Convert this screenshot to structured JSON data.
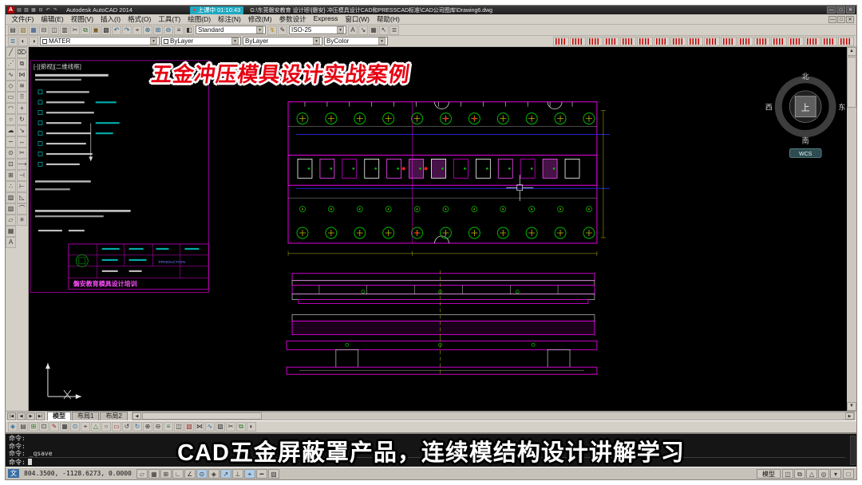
{
  "window": {
    "ui": {
      "dropdown_arrow": "▾",
      "scroll_up": "▲",
      "scroll_down": "▼",
      "scroll_left": "◀",
      "scroll_right": "▶"
    },
    "title_bar": {
      "logo": "A",
      "quick_icons": [
        {
          "name": "qat-new-icon",
          "glyph": "▤"
        },
        {
          "name": "qat-open-icon",
          "glyph": "▧"
        },
        {
          "name": "qat-save-icon",
          "glyph": "▦"
        },
        {
          "name": "qat-plot-icon",
          "glyph": "⊟"
        },
        {
          "name": "qat-undo-icon",
          "glyph": "↶"
        },
        {
          "name": "qat-redo-icon",
          "glyph": "↷"
        }
      ],
      "app_title": "Autodesk AutoCAD 2014",
      "recording_badge": {
        "dot": "●",
        "label": "上课中",
        "time": "01:10:43"
      },
      "doc_path": "G:\\东莞磐安教育 设计班\\[磐安]·冲压模具设计CAD和PRESSCAD标准\\CAD公司图库\\Drawing6.dwg",
      "window_buttons": [
        {
          "name": "minimize-button",
          "label": "—"
        },
        {
          "name": "restore-button",
          "label": "□"
        },
        {
          "name": "close-button",
          "label": "✕"
        }
      ]
    },
    "menu_bar": {
      "items": [
        {
          "name": "menu-file",
          "label": "文件(F)"
        },
        {
          "name": "menu-edit",
          "label": "编辑(E)"
        },
        {
          "name": "menu-view",
          "label": "视图(V)"
        },
        {
          "name": "menu-insert",
          "label": "插入(I)"
        },
        {
          "name": "menu-format",
          "label": "格式(O)"
        },
        {
          "name": "menu-tools",
          "label": "工具(T)"
        },
        {
          "name": "menu-draw",
          "label": "绘图(D)"
        },
        {
          "name": "menu-dimension",
          "label": "标注(N)"
        },
        {
          "name": "menu-modify",
          "label": "修改(M)"
        },
        {
          "name": "menu-parametric-design",
          "label": "参数设计"
        },
        {
          "name": "menu-express",
          "label": "Express"
        },
        {
          "name": "menu-window",
          "label": "窗口(W)"
        },
        {
          "name": "menu-help",
          "label": "帮助(H)"
        }
      ],
      "mdi_buttons": [
        {
          "name": "mdi-minimize-button",
          "label": "—"
        },
        {
          "name": "mdi-restore-button",
          "label": "□"
        },
        {
          "name": "mdi-close-button",
          "label": "✕"
        }
      ]
    },
    "toolbar_main": {
      "left_icons": [
        {
          "name": "new-icon",
          "glyph": "▤"
        },
        {
          "name": "open-icon",
          "glyph": "▧",
          "color": "#8a6d2a"
        },
        {
          "name": "save-icon",
          "glyph": "▦",
          "color": "#33568a"
        },
        {
          "name": "plot-icon",
          "glyph": "⊟"
        },
        {
          "name": "plot-preview-icon",
          "glyph": "◫"
        },
        {
          "name": "publish-icon",
          "glyph": "▥"
        },
        {
          "name": "cut-icon",
          "glyph": "✂"
        },
        {
          "name": "copy-clip-icon",
          "glyph": "⧉",
          "color": "#2e6b2e"
        },
        {
          "name": "paste-icon",
          "glyph": "▣",
          "color": "#7a5a1f"
        },
        {
          "name": "match-properties-icon",
          "glyph": "▩"
        },
        {
          "name": "undo-icon",
          "glyph": "↶",
          "color": "#1c5c8a"
        },
        {
          "name": "redo-icon",
          "glyph": "↷",
          "color": "#1c5c8a"
        },
        {
          "name": "pan-icon",
          "glyph": "⌖"
        },
        {
          "name": "zoom-realtime-icon",
          "glyph": "⊕",
          "color": "#1c5c8a"
        },
        {
          "name": "zoom-window-icon",
          "glyph": "⊞",
          "color": "#1c5c8a"
        },
        {
          "name": "zoom-previous-icon",
          "glyph": "⊖",
          "color": "#1c5c8a"
        },
        {
          "name": "properties-icon",
          "glyph": "≡"
        },
        {
          "name": "designcenter-icon",
          "glyph": "◧"
        }
      ],
      "style_combo": "Standard",
      "mid_icons": [
        {
          "name": "parametric-icon",
          "glyph": "↯",
          "color": "#b8860b"
        },
        {
          "name": "annotation-icon",
          "glyph": "✎"
        }
      ],
      "dim_combo": "ISO-25",
      "right_icons": [
        {
          "name": "text-style-icon",
          "glyph": "A"
        },
        {
          "name": "dim-style-icon",
          "glyph": "↘"
        },
        {
          "name": "table-style-icon",
          "glyph": "▦"
        },
        {
          "name": "mleader-style-icon",
          "glyph": "↖"
        },
        {
          "name": "layer-states-icon",
          "glyph": "≣"
        }
      ]
    },
    "toolbar_properties": {
      "layer_icons": [
        {
          "name": "layer-properties-icon",
          "glyph": "≣",
          "color": "#1c5c8a"
        },
        {
          "name": "layer-isolate-icon",
          "glyph": "◐"
        },
        {
          "name": "layer-unisolate-icon",
          "glyph": "◑"
        }
      ],
      "layer_combo": "MATER",
      "color_combo": "ByLayer",
      "linetype_combo": "ByLayer",
      "plot_combo": "ByColor",
      "presscad_tools": [
        {
          "name": "presscad-tool-icon"
        },
        {
          "name": "presscad-tool-icon"
        },
        {
          "name": "presscad-tool-icon"
        },
        {
          "name": "presscad-tool-icon"
        },
        {
          "name": "presscad-tool-icon"
        },
        {
          "name": "presscad-tool-icon"
        },
        {
          "name": "presscad-tool-icon"
        },
        {
          "name": "presscad-tool-icon"
        },
        {
          "name": "presscad-tool-icon"
        },
        {
          "name": "presscad-tool-icon"
        },
        {
          "name": "presscad-tool-icon"
        },
        {
          "name": "presscad-tool-icon"
        },
        {
          "name": "presscad-tool-icon"
        },
        {
          "name": "presscad-tool-icon"
        },
        {
          "name": "presscad-tool-icon"
        },
        {
          "name": "presscad-tool-icon"
        },
        {
          "name": "presscad-tool-icon"
        },
        {
          "name": "presscad-tool-icon"
        }
      ]
    },
    "left_dock": {
      "draw_icons": [
        {
          "name": "line-icon",
          "glyph": "╱"
        },
        {
          "name": "construction-line-icon",
          "glyph": "⋰"
        },
        {
          "name": "polyline-icon",
          "glyph": "∿"
        },
        {
          "name": "polygon-icon",
          "glyph": "◇"
        },
        {
          "name": "rectangle-icon",
          "glyph": "▭"
        },
        {
          "name": "arc-icon",
          "glyph": "◠"
        },
        {
          "name": "circle-icon",
          "glyph": "○"
        },
        {
          "name": "revision-cloud-icon",
          "glyph": "☁"
        },
        {
          "name": "spline-icon",
          "glyph": "∽"
        },
        {
          "name": "ellipse-icon",
          "glyph": "⊙"
        },
        {
          "name": "insert-block-icon",
          "glyph": "⊡"
        },
        {
          "name": "make-block-icon",
          "glyph": "⊞"
        },
        {
          "name": "point-icon",
          "glyph": "∴"
        },
        {
          "name": "hatch-icon",
          "glyph": "▨"
        },
        {
          "name": "gradient-icon",
          "glyph": "▧"
        },
        {
          "name": "region-icon",
          "glyph": "▱"
        },
        {
          "name": "table-icon",
          "glyph": "▦"
        },
        {
          "name": "multiline-text-icon",
          "glyph": "A"
        }
      ],
      "modify_icons": [
        {
          "name": "erase-icon",
          "glyph": "⌦"
        },
        {
          "name": "copy-icon",
          "glyph": "⧉"
        },
        {
          "name": "mirror-icon",
          "glyph": "⋈"
        },
        {
          "name": "offset-icon",
          "glyph": "≋"
        },
        {
          "name": "array-icon",
          "glyph": "⠿"
        },
        {
          "name": "move-icon",
          "glyph": "+"
        },
        {
          "name": "rotate-icon",
          "glyph": "↻"
        },
        {
          "name": "scale-icon",
          "glyph": "↘"
        },
        {
          "name": "stretch-icon",
          "glyph": "↔"
        },
        {
          "name": "trim-icon",
          "glyph": "✂"
        },
        {
          "name": "extend-icon",
          "glyph": "⟶"
        },
        {
          "name": "break-icon",
          "glyph": "⊣"
        },
        {
          "name": "join-icon",
          "glyph": "⊢"
        },
        {
          "name": "chamfer-icon",
          "glyph": "◺"
        },
        {
          "name": "fillet-icon",
          "glyph": "⌒"
        },
        {
          "name": "explode-icon",
          "glyph": "✳"
        }
      ]
    },
    "canvas": {
      "viewport_label": "[-][俯视][二维线框]",
      "title_block_company": "磐安教育模具设计培训",
      "title_block_production": "PRODUCTION"
    },
    "viewcube": {
      "north": "北",
      "south": "南",
      "west": "西",
      "east": "东",
      "top": "上",
      "wcs": "WCS"
    },
    "overlays": {
      "top_title": "五金冲压模具设计实战案例",
      "bottom_title": "CAD五金屏蔽罩产品，连续模结构设计讲解学习"
    },
    "tab_bar": {
      "nav": [
        {
          "name": "first-tab-button",
          "label": "|◀"
        },
        {
          "name": "prev-tab-button",
          "label": "◀"
        },
        {
          "name": "next-tab-button",
          "label": "▶"
        },
        {
          "name": "last-tab-button",
          "label": "▶|"
        }
      ],
      "tabs": [
        {
          "name": "tab-model",
          "label": "模型",
          "active": true
        },
        {
          "name": "tab-layout1",
          "label": "布局1"
        },
        {
          "name": "tab-layout2",
          "label": "布局2"
        }
      ]
    },
    "bottom_toolbar": {
      "icons": [
        {
          "name": "bottom-tool-icon",
          "glyph": "◈",
          "color": "#2b6b9a"
        },
        {
          "name": "bottom-tool-icon",
          "glyph": "▤"
        },
        {
          "name": "bottom-tool-icon",
          "glyph": "⊞",
          "color": "#2b7a2b"
        },
        {
          "name": "bottom-tool-icon",
          "glyph": "⊡"
        },
        {
          "name": "bottom-tool-icon",
          "glyph": "✎",
          "color": "#9a2b2b"
        },
        {
          "name": "bottom-tool-icon",
          "glyph": "▦"
        },
        {
          "name": "bottom-tool-icon",
          "glyph": "⊙",
          "color": "#2b6b9a"
        },
        {
          "name": "bottom-tool-icon",
          "glyph": "⌖"
        },
        {
          "name": "bottom-tool-icon",
          "glyph": "△",
          "color": "#2b7a2b"
        },
        {
          "name": "bottom-tool-icon",
          "glyph": "○"
        },
        {
          "name": "bottom-tool-icon",
          "glyph": "▭",
          "color": "#9a2b2b"
        },
        {
          "name": "bottom-tool-icon",
          "glyph": "↺"
        },
        {
          "name": "bottom-tool-icon",
          "glyph": "↻",
          "color": "#2b6b9a"
        },
        {
          "name": "bottom-tool-icon",
          "glyph": "⊕"
        },
        {
          "name": "bottom-tool-icon",
          "glyph": "⊖"
        },
        {
          "name": "bottom-tool-icon",
          "glyph": "≡",
          "color": "#2b7a2b"
        },
        {
          "name": "bottom-tool-icon",
          "glyph": "◫"
        },
        {
          "name": "bottom-tool-icon",
          "glyph": "▧",
          "color": "#9a2b2b"
        },
        {
          "name": "bottom-tool-icon",
          "glyph": "⋈"
        },
        {
          "name": "bottom-tool-icon",
          "glyph": "∿",
          "color": "#2b6b9a"
        },
        {
          "name": "bottom-tool-icon",
          "glyph": "▨"
        },
        {
          "name": "bottom-tool-icon",
          "glyph": "✂"
        },
        {
          "name": "bottom-tool-icon",
          "glyph": "⧉",
          "color": "#2b7a2b"
        },
        {
          "name": "bottom-tool-icon",
          "glyph": "◐"
        }
      ]
    },
    "command": {
      "lines": [
        "命令:",
        "命令:",
        "命令: _qsave"
      ],
      "prompt": "命令:"
    },
    "status_bar": {
      "ime": "文",
      "coords": "804.3500, -1128.6273, 0.0000",
      "toggles": [
        {
          "name": "infer-constraints-toggle",
          "glyph": "▱"
        },
        {
          "name": "snap-toggle",
          "glyph": "▦"
        },
        {
          "name": "grid-toggle",
          "glyph": "⊞"
        },
        {
          "name": "ortho-toggle",
          "glyph": "∟"
        },
        {
          "name": "polar-toggle",
          "glyph": "∠"
        },
        {
          "name": "osnap-toggle",
          "glyph": "⊙",
          "active": true
        },
        {
          "name": "osnap3d-toggle",
          "glyph": "◈"
        },
        {
          "name": "otrack-toggle",
          "glyph": "↗",
          "active": true
        },
        {
          "name": "ducs-toggle",
          "glyph": "⊥"
        },
        {
          "name": "dyn-toggle",
          "glyph": "⌖",
          "active": true
        },
        {
          "name": "lineweight-toggle",
          "glyph": "━"
        },
        {
          "name": "quickprops-toggle",
          "glyph": "▨"
        }
      ],
      "model_button": "模型",
      "right_icons": [
        {
          "name": "quick-view-layouts-icon",
          "glyph": "◫"
        },
        {
          "name": "quick-view-drawings-icon",
          "glyph": "⧉"
        },
        {
          "name": "annotation-scale-icon",
          "glyph": "△"
        },
        {
          "name": "workspace-switch-icon",
          "glyph": "◎"
        },
        {
          "name": "status-menu-icon",
          "glyph": "▾"
        }
      ],
      "clean_screen": "□"
    },
    "colors": {
      "canvas_bg": "#000000",
      "chrome": "#d4d0c8",
      "cad_magenta": "#ff00ff",
      "banner_red": "#e60012",
      "badge_teal": "#1fa9c0"
    }
  }
}
